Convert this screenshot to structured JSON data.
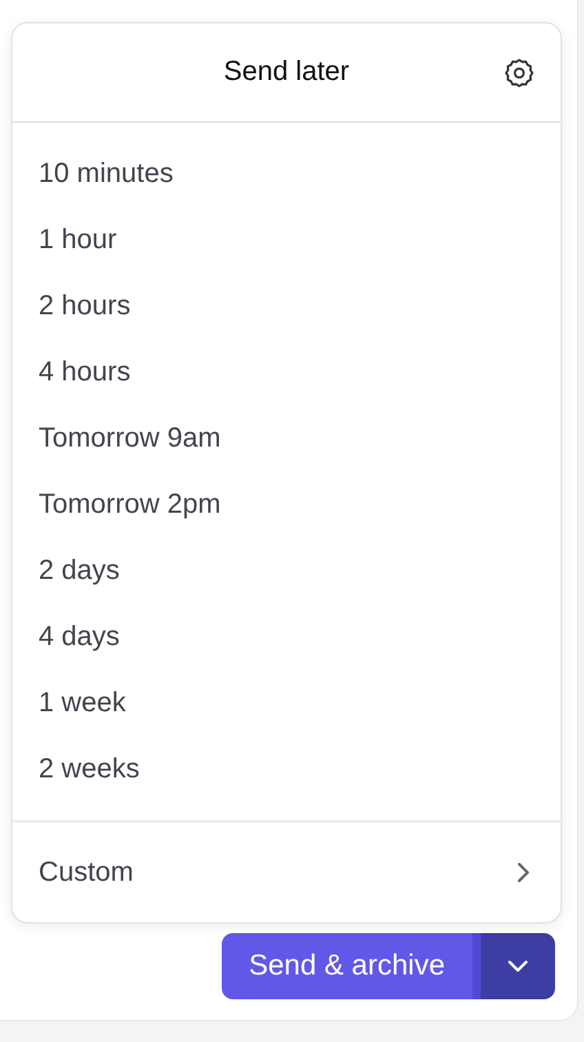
{
  "menu": {
    "title": "Send later",
    "options": [
      {
        "label": "10 minutes"
      },
      {
        "label": "1 hour"
      },
      {
        "label": "2 hours"
      },
      {
        "label": "4 hours"
      },
      {
        "label": "Tomorrow 9am"
      },
      {
        "label": "Tomorrow 2pm"
      },
      {
        "label": "2 days"
      },
      {
        "label": "4 days"
      },
      {
        "label": "1 week"
      },
      {
        "label": "2 weeks"
      }
    ],
    "custom": {
      "label": "Custom"
    }
  },
  "send_button": {
    "label": "Send & archive"
  }
}
